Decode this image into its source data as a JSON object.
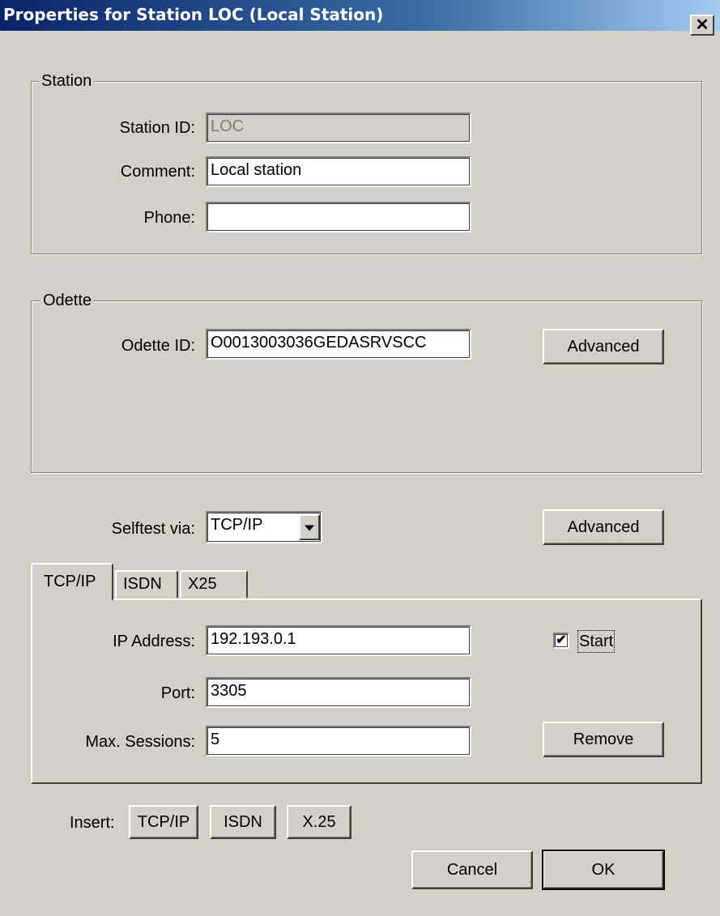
{
  "window": {
    "title": "Properties for Station LOC (Local Station)",
    "close_glyph": "✕"
  },
  "station": {
    "legend": "Station",
    "station_id_label": "Station ID:",
    "station_id_value": "LOC",
    "comment_label": "Comment:",
    "comment_value": "Local station",
    "phone_label": "Phone:",
    "phone_value": ""
  },
  "odette": {
    "legend": "Odette",
    "odette_id_label": "Odette ID:",
    "odette_id_value": "O0013003036GEDASRVSCC",
    "advanced_label": "Advanced"
  },
  "selftest": {
    "label": "Selftest via:",
    "selected": "TCP/IP",
    "advanced_label": "Advanced"
  },
  "tabs": [
    {
      "label": "TCP/IP",
      "active": true
    },
    {
      "label": "ISDN",
      "active": false
    },
    {
      "label": "X25",
      "active": false
    }
  ],
  "tcpip": {
    "ip_label": "IP Address:",
    "ip_value": "192.193.0.1",
    "port_label": "Port:",
    "port_value": "3305",
    "max_sessions_label": "Max. Sessions:",
    "max_sessions_value": "5",
    "start_label": "Start",
    "start_checked": true,
    "check_glyph": "✔",
    "remove_label": "Remove"
  },
  "insert": {
    "label": "Insert:",
    "tcpip_label": "TCP/IP",
    "isdn_label": "ISDN",
    "x25_label": "X.25"
  },
  "footer": {
    "cancel_label": "Cancel",
    "ok_label": "OK"
  }
}
